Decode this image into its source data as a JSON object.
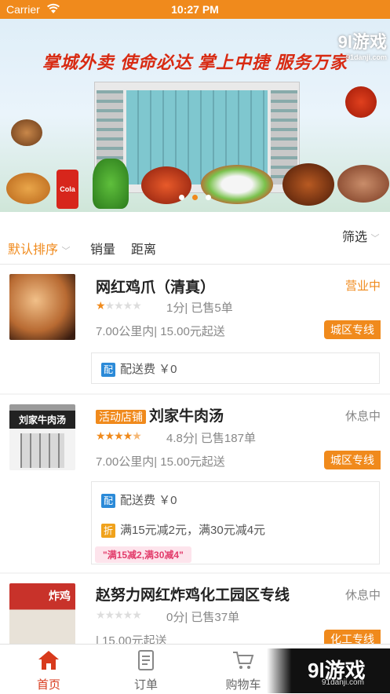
{
  "status_bar": {
    "carrier": "Carrier",
    "time": "10:27 PM"
  },
  "banner": {
    "slogan": "掌城外卖  使命必达  掌上中捷  服务万家",
    "watermark": "9l游戏",
    "watermark_url": "91danji.com",
    "cola_text": "Cola",
    "slide_count": 3,
    "active_slide": 1
  },
  "filters": {
    "default_sort": "默认排序",
    "sales": "销量",
    "distance": "距离",
    "screen": "筛选"
  },
  "shops": [
    {
      "name": "网红鸡爪（清真）",
      "status": "营业中",
      "status_color": "#f08a1c",
      "rating": 1,
      "rating_text": "1分| 已售5单",
      "distance_text": "7.00公里内| 15.00元起送",
      "area_tag": "城区专线",
      "delivery_icon": "配",
      "delivery_text": "配送费 ￥0"
    },
    {
      "activity_tag": "活动店铺",
      "name": "刘家牛肉汤",
      "status": "休息中",
      "status_color": "#888888",
      "rating": 4.5,
      "rating_text": "4.8分| 已售187单",
      "distance_text": "7.00公里内| 15.00元起送",
      "area_tag": "城区专线",
      "delivery_icon": "配",
      "delivery_text": "配送费 ￥0",
      "discount_icon": "折",
      "discount_text": "满15元减2元，满30元减4元",
      "promo_pill": "\"满15减2,满30减4\"",
      "img_sign": "刘家牛肉汤"
    },
    {
      "name": "赵努力网红炸鸡化工园区专线",
      "status": "休息中",
      "status_color": "#888888",
      "rating": 0,
      "rating_text": "0分| 已售37单",
      "distance_text": "| 15.00元起送",
      "area_tag": "化工专线",
      "img_sign": "炸鸡"
    }
  ],
  "tabs": {
    "home": "首页",
    "orders": "订单",
    "cart": "购物车"
  },
  "corner_mark": {
    "logo": "9l游戏",
    "url": "91danji.com"
  },
  "colors": {
    "accent": "#f08a1c",
    "tab_active": "#d83a1c"
  }
}
